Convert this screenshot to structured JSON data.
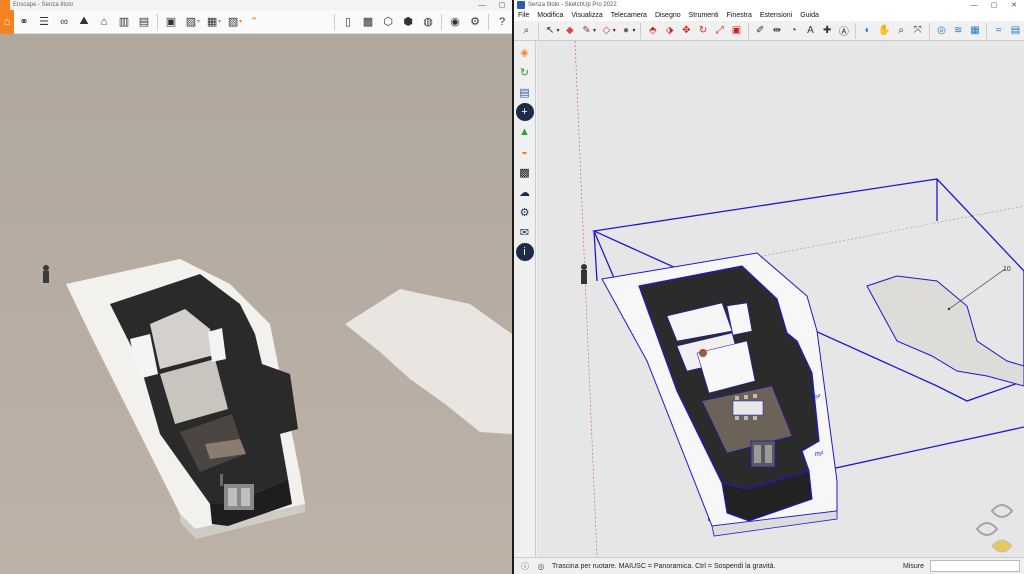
{
  "enscape": {
    "title": "Enscape - Senza titolo",
    "toolbar_icons": [
      "home-icon",
      "link-icon",
      "list-icon",
      "binoculars-icon",
      "mountain-icon",
      "panorama-icon",
      "books-icon",
      "clapper-icon",
      "render-icon",
      "image-export-icon",
      "exe-export-icon",
      "web-export-icon",
      "collapse-icon",
      "map-icon",
      "video-editor-icon",
      "cube-icon",
      "materials-icon",
      "view-management-icon",
      "visual-settings-icon",
      "settings-icon",
      "help-icon"
    ],
    "window_controls": [
      "—",
      "▢",
      "✕"
    ]
  },
  "sketchup": {
    "title": "Senza titolo - SketchUp Pro 2022",
    "menu": [
      "File",
      "Modifica",
      "Visualizza",
      "Telecamera",
      "Disegno",
      "Strumenti",
      "Finestra",
      "Estensioni",
      "Guida"
    ],
    "window_controls": [
      "—",
      "▢",
      "✕"
    ],
    "viewport_labels": {
      "dim_right": "10",
      "area_a": "m²",
      "area_b": "m²"
    },
    "status": {
      "message": "Trascina per ruotare. MAIUSC = Panoramica. Ctrl = Sospendi la gravità.",
      "measure_label": "Misure",
      "measure_value": ""
    }
  },
  "colors": {
    "enscape_orange": "#f58220",
    "selection_blue": "#1a1ad6",
    "ground_tan": "#b9aea4",
    "su_ground": "#e4e4e4"
  }
}
